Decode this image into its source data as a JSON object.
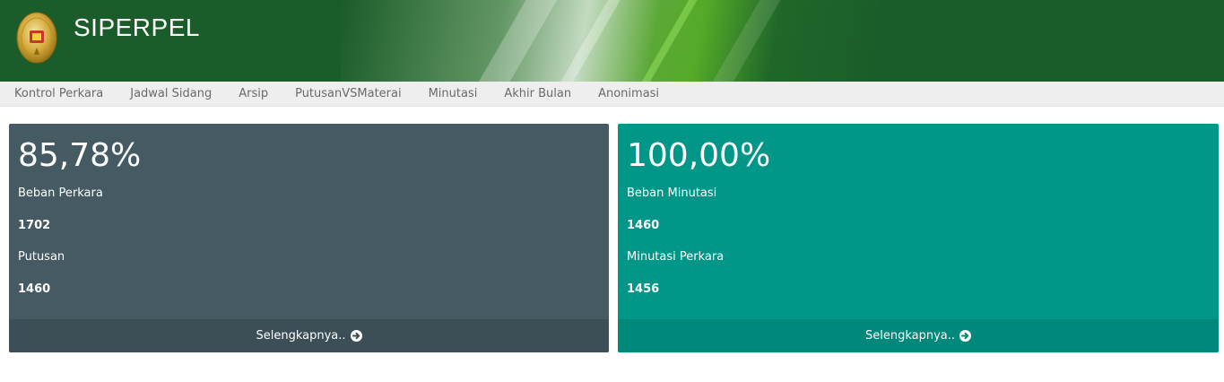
{
  "header": {
    "app_title": "SIPERPEL",
    "logo_icon": "court-emblem-icon"
  },
  "nav": {
    "items": [
      {
        "label": "Kontrol Perkara"
      },
      {
        "label": "Jadwal Sidang"
      },
      {
        "label": "Arsip"
      },
      {
        "label": "PutusanVSMaterai"
      },
      {
        "label": "Minutasi"
      },
      {
        "label": "Akhir Bulan"
      },
      {
        "label": "Anonimasi"
      }
    ]
  },
  "cards": [
    {
      "percentage": "85,78%",
      "label1": "Beban Perkara",
      "value1": "1702",
      "label2": "Putusan",
      "value2": "1460",
      "footer_label": "Selengkapnya..",
      "footer_icon": "arrow-circle-right-icon",
      "color": "#455a62"
    },
    {
      "percentage": "100,00%",
      "label1": "Beban Minutasi",
      "value1": "1460",
      "label2": "Minutasi Perkara",
      "value2": "1456",
      "footer_label": "Selengkapnya..",
      "footer_icon": "arrow-circle-right-icon",
      "color": "#009688"
    }
  ],
  "colors": {
    "header_bg": "#1a5c2a",
    "nav_bg": "#eeeeee",
    "card_left": "#455a62",
    "card_right": "#009688"
  }
}
